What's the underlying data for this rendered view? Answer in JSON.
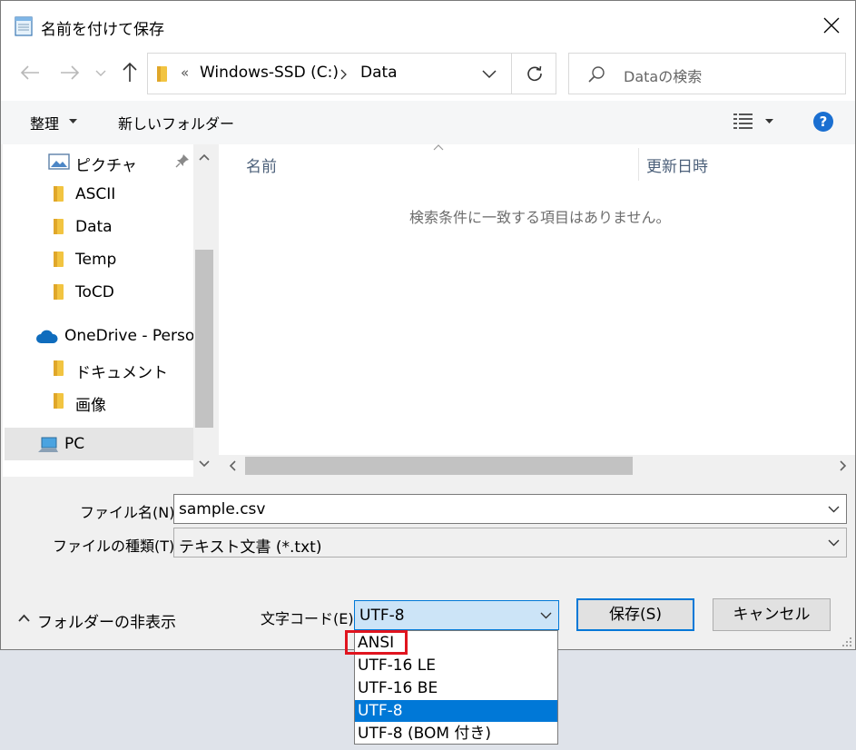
{
  "window": {
    "title": "名前を付けて保存"
  },
  "nav": {
    "breadcrumb_overflow": "«",
    "breadcrumb": [
      "Windows-SSD (C:)",
      "Data"
    ],
    "search_placeholder": "Dataの検索"
  },
  "toolbar": {
    "organize_label": "整理",
    "new_folder_label": "新しいフォルダー"
  },
  "sidebar": {
    "items": [
      {
        "label": "ピクチャ",
        "icon": "pictures-icon"
      },
      {
        "label": "ASCII",
        "icon": "folder-icon"
      },
      {
        "label": "Data",
        "icon": "folder-icon"
      },
      {
        "label": "Temp",
        "icon": "folder-icon"
      },
      {
        "label": "ToCD",
        "icon": "folder-icon"
      },
      {
        "label": "OneDrive - Person",
        "icon": "cloud-icon"
      },
      {
        "label": "ドキュメント",
        "icon": "folder-icon"
      },
      {
        "label": "画像",
        "icon": "folder-icon"
      },
      {
        "label": "PC",
        "icon": "computer-icon"
      }
    ]
  },
  "filelist": {
    "columns": [
      "名前",
      "更新日時"
    ],
    "empty_message": "検索条件に一致する項目はありません。"
  },
  "form": {
    "filename_label": "ファイル名(N):",
    "filename_value": "sample.csv",
    "filetype_label": "ファイルの種類(T):",
    "filetype_value": "テキスト文書 (*.txt)",
    "hide_folders_label": "フォルダーの非表示",
    "encoding_label": "文字コード(E):",
    "encoding_value": "UTF-8",
    "save_label": "保存(S)",
    "cancel_label": "キャンセル"
  },
  "encoding_options": [
    "ANSI",
    "UTF-16 LE",
    "UTF-16 BE",
    "UTF-8",
    "UTF-8 (BOM 付き)"
  ],
  "colors": {
    "accent": "#0078d7",
    "highlight_box": "#e0141e",
    "help": "#1a6fd1"
  }
}
